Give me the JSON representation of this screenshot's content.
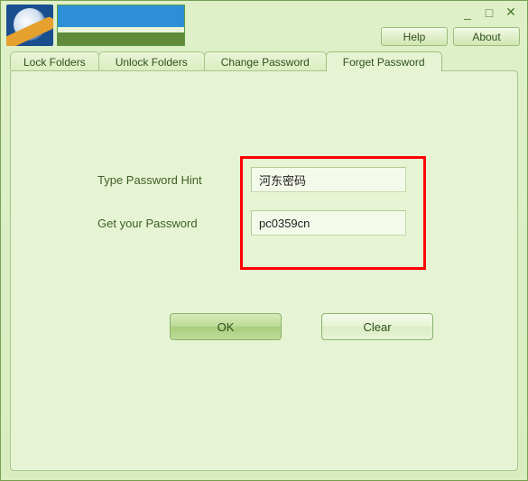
{
  "window_controls": {
    "minimize": "_",
    "maximize": "□",
    "close": "✕"
  },
  "header_buttons": {
    "help": "Help",
    "about": "About"
  },
  "tabs": {
    "lock": "Lock Folders",
    "unlock": "Unlock Folders",
    "change": "Change Password",
    "forget": "Forget Password"
  },
  "form": {
    "hint_label": "Type Password Hint",
    "hint_value": "河东密码",
    "get_label": "Get your Password",
    "get_value": "pc0359cn"
  },
  "buttons": {
    "ok": "OK",
    "clear": "Clear"
  }
}
